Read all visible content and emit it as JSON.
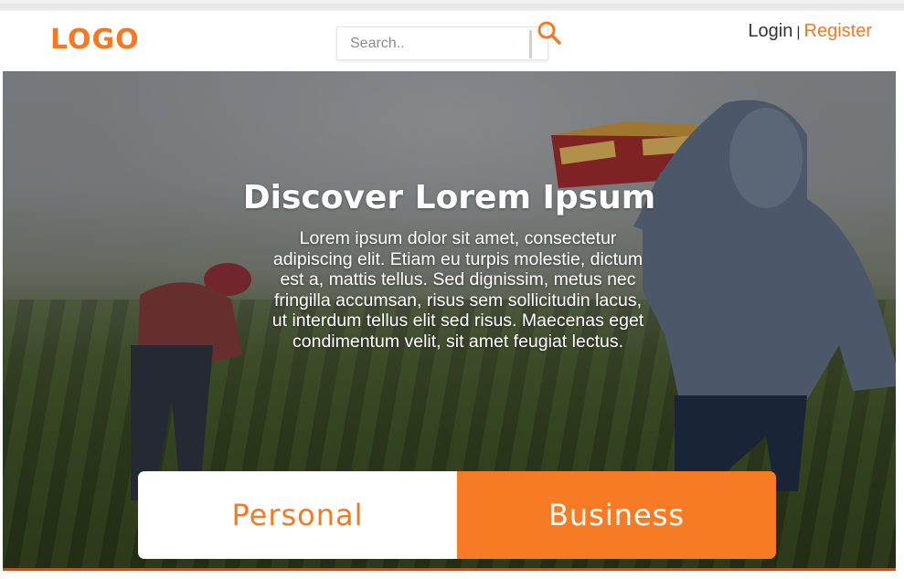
{
  "header": {
    "logo_text": "LOGO",
    "search": {
      "placeholder": "Search..",
      "value": ""
    },
    "search_button_icon": "search-icon",
    "login_label": "Login",
    "separator": "|",
    "register_label": "Register"
  },
  "hero": {
    "title": "Discover Lorem Ipsum",
    "body": "Lorem ipsum dolor sit amet, consectetur adipiscing elit. Etiam eu turpis molestie, dictum est a, mattis tellus. Sed dignissim, metus nec fringilla accumsan, risus sem sollicitudin lacus, ut interdum tellus elit sed risus. Maecenas eget condimentum velit, sit amet feugiat lectus."
  },
  "tabs": {
    "personal_label": "Personal",
    "business_label": "Business"
  },
  "colors": {
    "accent": "#f57922",
    "button_orange": "#f77a24",
    "text_dark": "#333333"
  }
}
